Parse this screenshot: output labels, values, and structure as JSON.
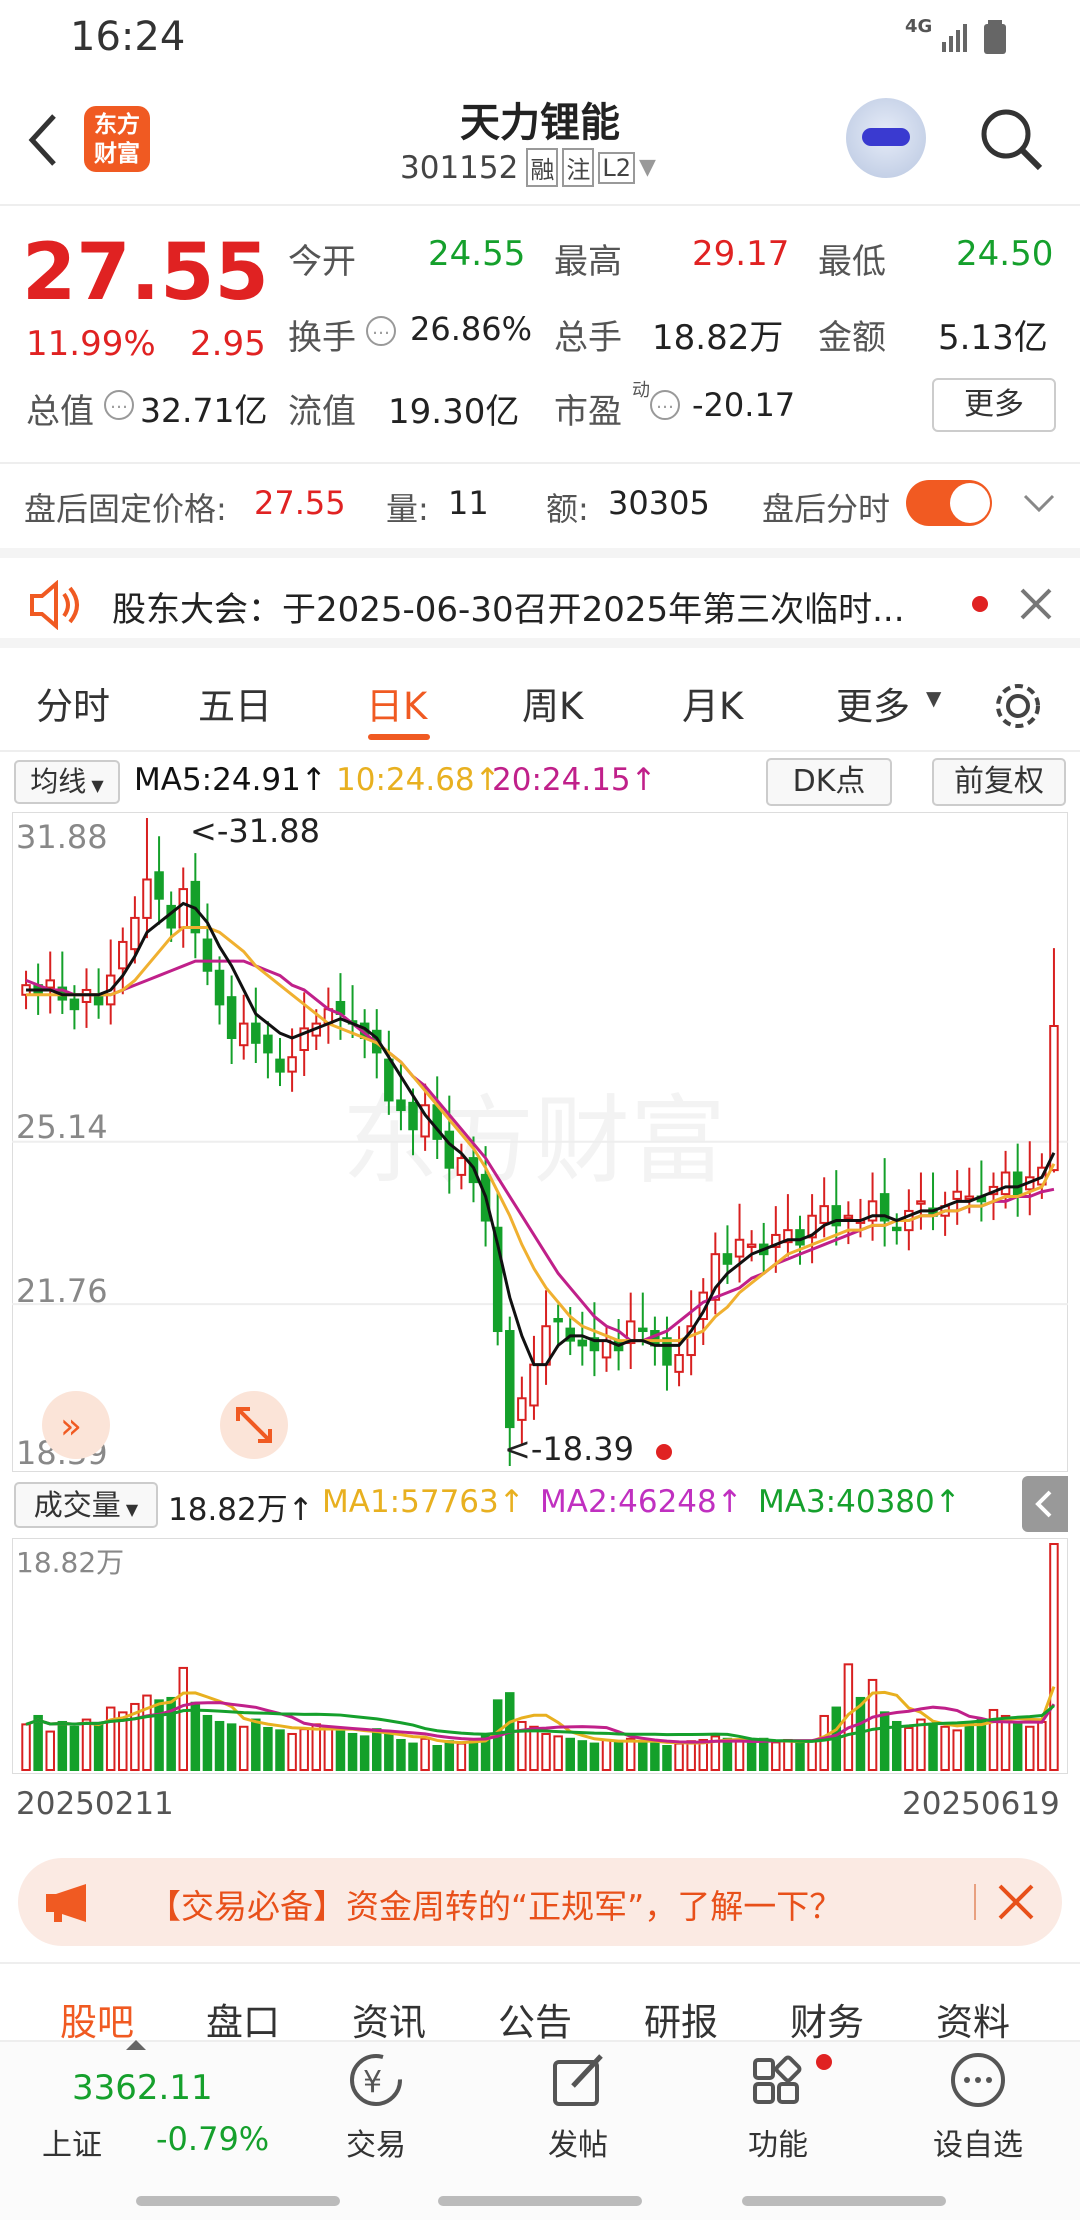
{
  "status": {
    "time": "16:24",
    "network": "4G"
  },
  "header": {
    "title": "天力锂能",
    "code": "301152",
    "badges": [
      "融",
      "注",
      "L2"
    ],
    "logo_line1": "东方",
    "logo_line2": "财富"
  },
  "quote": {
    "price": "27.55",
    "change_pct": "11.99%",
    "change": "2.95",
    "open_label": "今开",
    "open": "24.55",
    "high_label": "最高",
    "high": "29.17",
    "low_label": "最低",
    "low": "24.50",
    "turnover_label": "换手",
    "turnover": "26.86%",
    "volume_label": "总手",
    "volume": "18.82万",
    "amount_label": "金额",
    "amount": "5.13亿",
    "mcap_label": "总值",
    "mcap": "32.71亿",
    "float_label": "流值",
    "float": "19.30亿",
    "pe_label": "市盈",
    "pe_sup": "动",
    "pe": "-20.17",
    "more": "更多"
  },
  "after_hours": {
    "price_label": "盘后固定价格:",
    "price": "27.55",
    "vol_label": "量:",
    "vol": "11",
    "amt_label": "额:",
    "amt": "30305",
    "toggle_label": "盘后分时",
    "toggle_on": true
  },
  "notice": {
    "text": "股东大会：于2025-06-30召开2025年第三次临时..."
  },
  "tabs": [
    "分时",
    "五日",
    "日K",
    "周K",
    "月K",
    "更多"
  ],
  "active_tab": "日K",
  "ma": {
    "selector": "均线",
    "ma5": "MA5:24.91↑",
    "ma10": "10:24.68↑",
    "ma20": "20:24.15↑",
    "dk": "DK点",
    "adj": "前复权"
  },
  "chart_data": [
    {
      "type": "candlestick",
      "title": "",
      "x_range": [
        "20250211",
        "20250619"
      ],
      "y_ticks": [
        "31.88",
        "25.14",
        "21.76",
        "18.39"
      ],
      "ylim": [
        18.39,
        31.88
      ],
      "annotations": [
        "<-31.88",
        "<-18.39"
      ],
      "watermark": "东方财富",
      "series": [
        {
          "name": "MA5",
          "color": "#111111"
        },
        {
          "name": "MA10",
          "color": "#f0b030"
        },
        {
          "name": "MA20",
          "color": "#c0208a"
        }
      ],
      "closes": [
        28.4,
        28.2,
        28.5,
        28.1,
        27.9,
        28.3,
        28.0,
        28.6,
        29.3,
        29.8,
        30.6,
        30.2,
        29.6,
        30.4,
        29.5,
        28.7,
        28.0,
        27.3,
        27.6,
        27.2,
        27.0,
        26.6,
        26.9,
        27.5,
        27.6,
        27.9,
        27.8,
        27.6,
        27.3,
        27.0,
        26.0,
        25.8,
        25.4,
        25.9,
        25.2,
        24.6,
        24.8,
        24.3,
        23.5,
        21.2,
        19.2,
        19.8,
        20.5,
        21.3,
        21.4,
        21.0,
        20.9,
        20.8,
        21.0,
        20.8,
        21.4,
        21.2,
        20.9,
        20.5,
        20.7,
        21.3,
        22.0,
        22.8,
        22.6,
        23.1,
        23.0,
        22.8,
        23.2,
        23.3,
        23.0,
        23.6,
        23.8,
        23.4,
        23.6,
        23.5,
        23.9,
        23.5,
        23.3,
        23.7,
        23.9,
        23.6,
        23.8,
        24.1,
        24.0,
        23.9,
        24.2,
        24.5,
        24.0,
        24.4,
        24.6,
        27.55
      ],
      "ma5": [
        28.3,
        28.3,
        28.3,
        28.2,
        28.2,
        28.2,
        28.2,
        28.3,
        28.6,
        29.0,
        29.5,
        29.7,
        29.9,
        30.1,
        30.0,
        29.7,
        29.2,
        28.8,
        28.3,
        27.8,
        27.6,
        27.4,
        27.3,
        27.4,
        27.5,
        27.6,
        27.7,
        27.6,
        27.5,
        27.3,
        26.9,
        26.5,
        26.1,
        25.7,
        25.4,
        25.1,
        24.9,
        24.6,
        24.0,
        23.0,
        21.9,
        21.1,
        20.5,
        20.5,
        20.9,
        21.1,
        21.1,
        21.0,
        21.0,
        20.9,
        21.0,
        21.0,
        20.9,
        20.9,
        20.9,
        21.2,
        21.6,
        22.1,
        22.4,
        22.6,
        22.8,
        22.9,
        23.0,
        23.1,
        23.1,
        23.2,
        23.4,
        23.5,
        23.5,
        23.5,
        23.6,
        23.6,
        23.5,
        23.6,
        23.7,
        23.7,
        23.8,
        23.9,
        23.9,
        24.0,
        24.1,
        24.2,
        24.2,
        24.3,
        24.4,
        24.91
      ],
      "ma10": [
        28.2,
        28.2,
        28.2,
        28.2,
        28.2,
        28.2,
        28.2,
        28.2,
        28.3,
        28.5,
        28.8,
        29.1,
        29.4,
        29.6,
        29.6,
        29.6,
        29.5,
        29.3,
        29.1,
        28.8,
        28.6,
        28.4,
        28.2,
        28.0,
        27.8,
        27.6,
        27.5,
        27.4,
        27.3,
        27.2,
        27.0,
        26.8,
        26.5,
        26.2,
        25.9,
        25.6,
        25.3,
        25.0,
        24.6,
        24.1,
        23.6,
        23.0,
        22.5,
        22.1,
        21.8,
        21.5,
        21.3,
        21.2,
        21.1,
        21.0,
        21.0,
        21.0,
        21.0,
        21.0,
        21.0,
        21.1,
        21.2,
        21.5,
        21.7,
        22.0,
        22.2,
        22.4,
        22.6,
        22.8,
        22.9,
        23.0,
        23.1,
        23.2,
        23.3,
        23.3,
        23.4,
        23.4,
        23.5,
        23.5,
        23.6,
        23.6,
        23.7,
        23.7,
        23.8,
        23.8,
        23.9,
        24.0,
        24.0,
        24.1,
        24.2,
        24.68
      ],
      "ma20": [
        28.5,
        28.4,
        28.3,
        28.3,
        28.2,
        28.2,
        28.2,
        28.2,
        28.3,
        28.4,
        28.5,
        28.6,
        28.7,
        28.8,
        28.9,
        28.9,
        28.9,
        28.9,
        28.9,
        28.8,
        28.7,
        28.6,
        28.4,
        28.3,
        28.1,
        27.9,
        27.8,
        27.6,
        27.4,
        27.2,
        27.0,
        26.8,
        26.5,
        26.3,
        26.0,
        25.7,
        25.4,
        25.1,
        24.8,
        24.4,
        24.0,
        23.6,
        23.2,
        22.8,
        22.4,
        22.1,
        21.8,
        21.5,
        21.3,
        21.2,
        21.0,
        21.0,
        21.1,
        21.2,
        21.4,
        21.6,
        21.8,
        21.9,
        22.0,
        22.1,
        22.3,
        22.4,
        22.6,
        22.7,
        22.8,
        22.9,
        23.0,
        23.1,
        23.2,
        23.3,
        23.4,
        23.4,
        23.5,
        23.5,
        23.6,
        23.6,
        23.7,
        23.7,
        23.8,
        23.8,
        23.9,
        23.9,
        24.0,
        24.0,
        24.1,
        24.15
      ]
    },
    {
      "type": "bar",
      "title": "",
      "y_ticks": [
        "18.82万"
      ],
      "ylim": [
        0,
        188200
      ],
      "series": [
        {
          "name": "MA1",
          "color": "#e8b020"
        },
        {
          "name": "MA2",
          "color": "#c0208a"
        },
        {
          "name": "MA3",
          "color": "#15a02c"
        }
      ],
      "volumes": [
        38000,
        45000,
        32000,
        40000,
        36000,
        42000,
        39000,
        52000,
        48000,
        55000,
        62000,
        58000,
        60000,
        85000,
        56000,
        45000,
        40000,
        38000,
        36000,
        42000,
        35000,
        33000,
        30000,
        34000,
        38000,
        36000,
        32000,
        30000,
        28000,
        34000,
        30000,
        25000,
        22000,
        26000,
        20000,
        24000,
        22000,
        25000,
        30000,
        58000,
        64000,
        40000,
        36000,
        30000,
        28000,
        26000,
        24000,
        22000,
        25000,
        23000,
        26000,
        24000,
        22000,
        20000,
        22000,
        24000,
        25000,
        28000,
        26000,
        24000,
        22000,
        26000,
        23000,
        25000,
        22000,
        24000,
        45000,
        52000,
        88000,
        60000,
        75000,
        48000,
        40000,
        35000,
        42000,
        38000,
        36000,
        33000,
        40000,
        42000,
        50000,
        45000,
        38000,
        36000,
        40000,
        188200
      ]
    }
  ],
  "volume_row": {
    "selector": "成交量",
    "value": "18.82万↑",
    "ma1": "MA1:57763↑",
    "ma2": "MA2:46248↑",
    "ma3": "MA3:40380↑"
  },
  "dates": {
    "start": "20250211",
    "end": "20250619"
  },
  "ad": {
    "text": "【交易必备】资金周转的“正规军”，了解一下？"
  },
  "bottom_tabs": [
    "股吧",
    "盘口",
    "资讯",
    "公告",
    "研报",
    "财务",
    "资料"
  ],
  "nav": {
    "index_value": "3362.11",
    "index_name": "上证",
    "index_change": "-0.79%",
    "items": [
      "交易",
      "发帖",
      "功能",
      "设自选"
    ]
  }
}
